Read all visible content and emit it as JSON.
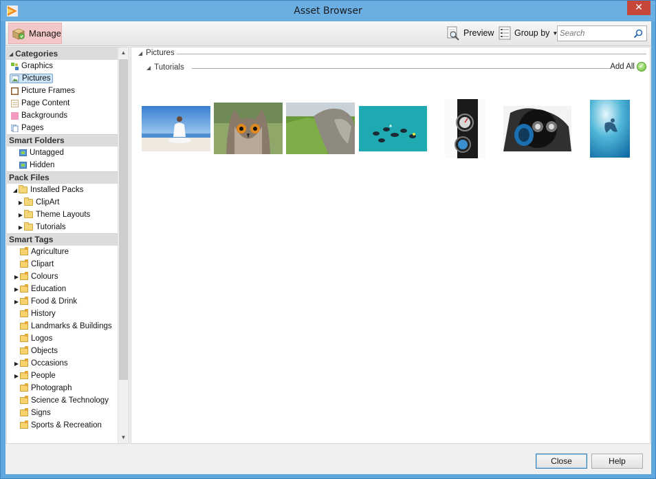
{
  "window": {
    "title": "Asset Browser",
    "close_glyph": "✕"
  },
  "toolbar": {
    "manage_label": "Manage",
    "preview_label": "Preview",
    "group_by_label": "Group by",
    "search_placeholder": "Search"
  },
  "sidebar": {
    "categories": {
      "title": "Categories",
      "items": [
        {
          "label": "Graphics",
          "icon": "graphics-icon"
        },
        {
          "label": "Pictures",
          "icon": "pictures-icon",
          "selected": true
        },
        {
          "label": "Picture Frames",
          "icon": "picture-frames-icon"
        },
        {
          "label": "Page Content",
          "icon": "page-content-icon"
        },
        {
          "label": "Backgrounds",
          "icon": "backgrounds-icon"
        },
        {
          "label": "Pages",
          "icon": "pages-icon"
        }
      ]
    },
    "smart_folders": {
      "title": "Smart Folders",
      "items": [
        {
          "label": "Untagged"
        },
        {
          "label": "Hidden"
        }
      ]
    },
    "pack_files": {
      "title": "Pack Files",
      "installed": "Installed Packs",
      "children": [
        {
          "label": "ClipArt"
        },
        {
          "label": "Theme Layouts"
        },
        {
          "label": "Tutorials"
        }
      ]
    },
    "smart_tags": {
      "title": "Smart Tags",
      "items": [
        {
          "label": "Agriculture",
          "expandable": false
        },
        {
          "label": "Clipart",
          "expandable": false
        },
        {
          "label": "Colours",
          "expandable": true
        },
        {
          "label": "Education",
          "expandable": true
        },
        {
          "label": "Food & Drink",
          "expandable": true
        },
        {
          "label": "History",
          "expandable": false
        },
        {
          "label": "Landmarks & Buildings",
          "expandable": false
        },
        {
          "label": "Logos",
          "expandable": false
        },
        {
          "label": "Objects",
          "expandable": false
        },
        {
          "label": "Occasions",
          "expandable": true
        },
        {
          "label": "People",
          "expandable": true
        },
        {
          "label": "Photograph",
          "expandable": false
        },
        {
          "label": "Science & Technology",
          "expandable": false
        },
        {
          "label": "Signs",
          "expandable": false
        },
        {
          "label": "Sports & Recreation",
          "expandable": false
        }
      ]
    }
  },
  "content": {
    "group_title": "Pictures",
    "subgroup_title": "Tutorials",
    "add_all_label": "Add All",
    "thumbnails": [
      {
        "name": "yoga-beach-thumbnail"
      },
      {
        "name": "owl-thumbnail"
      },
      {
        "name": "rocky-field-thumbnail"
      },
      {
        "name": "divers-group-thumbnail"
      },
      {
        "name": "dive-gauge-thumbnail"
      },
      {
        "name": "dive-regulator-thumbnail"
      },
      {
        "name": "diver-blue-thumbnail"
      }
    ]
  },
  "footer": {
    "close_label": "Close",
    "help_label": "Help"
  }
}
